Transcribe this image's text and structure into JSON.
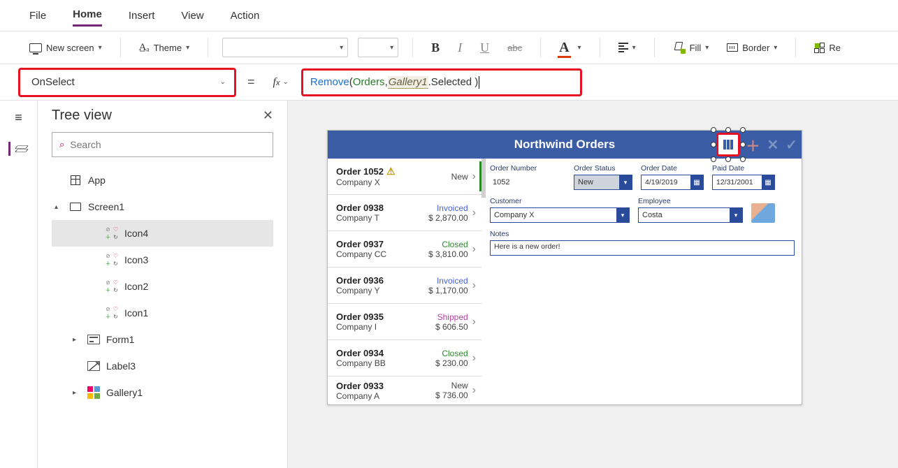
{
  "menu": {
    "file": "File",
    "home": "Home",
    "insert": "Insert",
    "view": "View",
    "action": "Action"
  },
  "ribbon": {
    "new_screen": "New screen",
    "theme": "Theme",
    "fill": "Fill",
    "border": "Border",
    "reorder": "Re"
  },
  "property_selector": {
    "value": "OnSelect"
  },
  "formula": {
    "func": "Remove",
    "open": "( ",
    "obj": "Orders",
    "comma": ", ",
    "ref": "Gallery1",
    "tail": ".Selected )"
  },
  "tree": {
    "title": "Tree view",
    "search_placeholder": "Search",
    "app": "App",
    "screen": "Screen1",
    "items": [
      {
        "label": "Icon4",
        "type": "icon"
      },
      {
        "label": "Icon3",
        "type": "icon"
      },
      {
        "label": "Icon2",
        "type": "icon"
      },
      {
        "label": "Icon1",
        "type": "icon"
      },
      {
        "label": "Form1",
        "type": "form"
      },
      {
        "label": "Label3",
        "type": "label"
      },
      {
        "label": "Gallery1",
        "type": "gallery"
      }
    ]
  },
  "app_preview": {
    "title": "Northwind Orders",
    "gallery": [
      {
        "order": "Order 1052",
        "company": "Company X",
        "status": "New",
        "amount": "",
        "warn": true,
        "selected": true
      },
      {
        "order": "Order 0938",
        "company": "Company T",
        "status": "Invoiced",
        "amount": "$ 2,870.00"
      },
      {
        "order": "Order 0937",
        "company": "Company CC",
        "status": "Closed",
        "amount": "$ 3,810.00"
      },
      {
        "order": "Order 0936",
        "company": "Company Y",
        "status": "Invoiced",
        "amount": "$ 1,170.00"
      },
      {
        "order": "Order 0935",
        "company": "Company I",
        "status": "Shipped",
        "amount": "$ 606.50"
      },
      {
        "order": "Order 0934",
        "company": "Company BB",
        "status": "Closed",
        "amount": "$ 230.00"
      },
      {
        "order": "Order 0933",
        "company": "Company A",
        "status": "New",
        "amount": "$ 736.00"
      }
    ],
    "detail": {
      "order_number_label": "Order Number",
      "order_number": "1052",
      "order_status_label": "Order Status",
      "order_status": "New",
      "order_date_label": "Order Date",
      "order_date": "4/19/2019",
      "paid_date_label": "Paid Date",
      "paid_date": "12/31/2001",
      "customer_label": "Customer",
      "customer": "Company X",
      "employee_label": "Employee",
      "employee": "Costa",
      "notes_label": "Notes",
      "notes": "Here is a new order!"
    }
  }
}
